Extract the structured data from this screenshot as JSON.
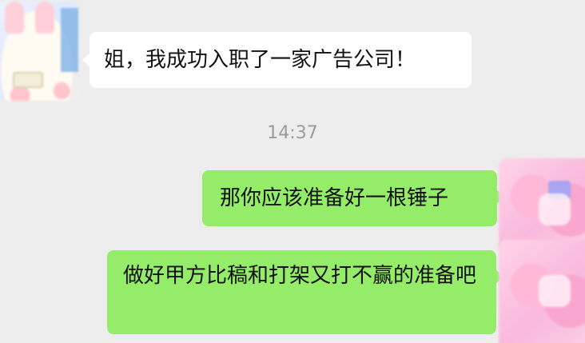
{
  "messages": [
    {
      "side": "left",
      "text": "姐，我成功入职了一家广告公司！"
    },
    {
      "side": "right",
      "text": "那你应该准备好一根锤子"
    },
    {
      "side": "right",
      "text": "做好甲方比稿和打架又打不赢的准备吧"
    }
  ],
  "timestamp": "14:37",
  "colors": {
    "background": "#ededed",
    "incoming_bubble": "#ffffff",
    "outgoing_bubble": "#95ec69",
    "timestamp": "#9b9b9b"
  }
}
